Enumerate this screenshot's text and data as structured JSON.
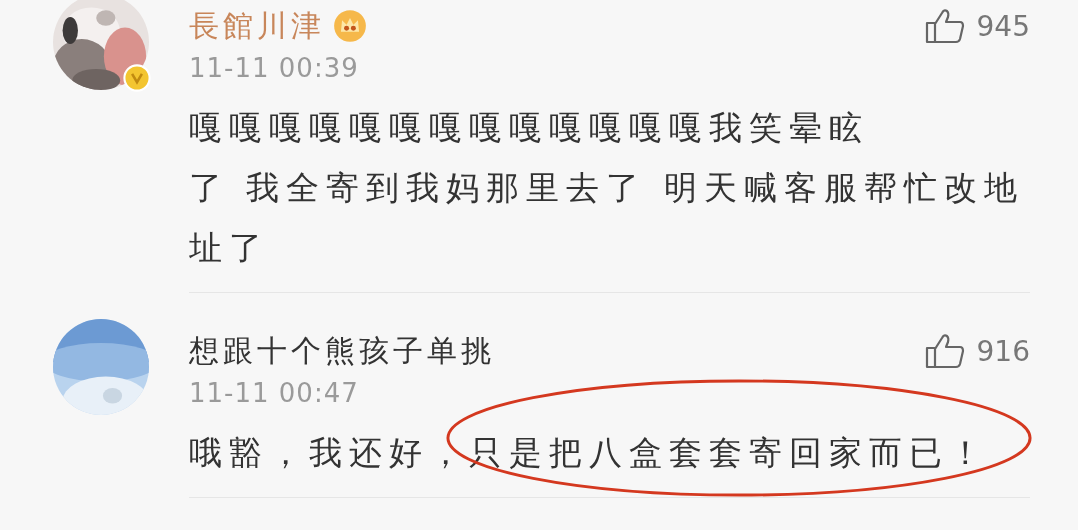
{
  "comments": [
    {
      "user": "長館川津",
      "has_crown": true,
      "verified": true,
      "avatar": {
        "kind": "picture"
      },
      "time": "11-11 00:39",
      "likes": "945",
      "lines": [
        "嘎嘎嘎嘎嘎嘎嘎嘎嘎嘎嘎嘎嘎我笑晕眩",
        "了 我全寄到我妈那里去了 明天喊客服帮忙改地",
        "址了"
      ]
    },
    {
      "user": "想跟十个熊孩子单挑",
      "has_crown": false,
      "verified": false,
      "avatar": {
        "kind": "picture"
      },
      "time": "11-11 00:47",
      "likes": "916",
      "body": [
        {
          "text": "哦豁，我还好，",
          "circled": false
        },
        {
          "text": "只是把八盒套套寄回家而已！",
          "circled": true
        }
      ]
    }
  ]
}
